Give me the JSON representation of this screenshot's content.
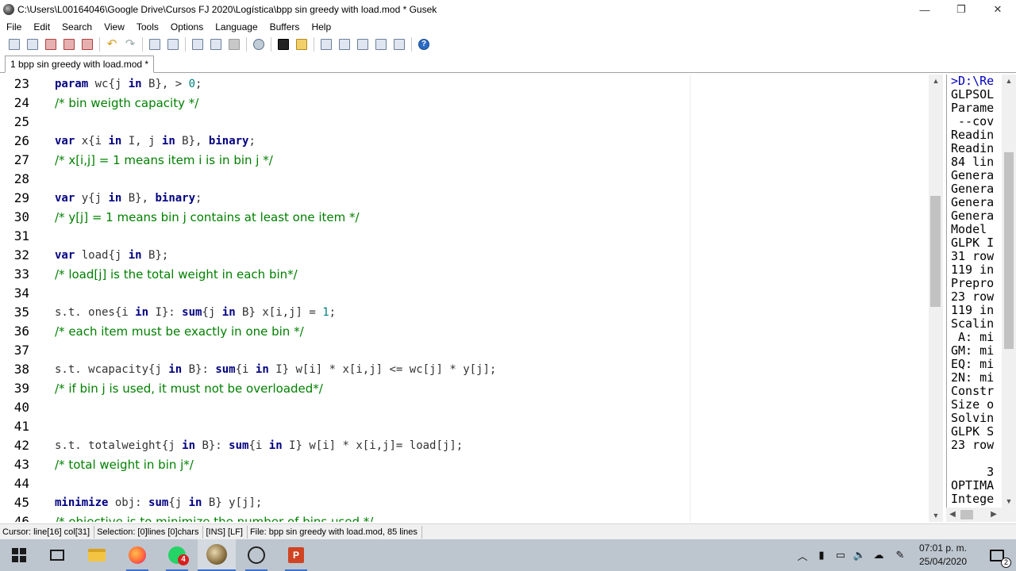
{
  "window": {
    "title": "C:\\Users\\L00164046\\Google Drive\\Cursos FJ 2020\\Logística\\bpp sin greedy with load.mod * Gusek",
    "minimize": "—",
    "restore": "❐",
    "close": "✕"
  },
  "menu": [
    "File",
    "Edit",
    "Search",
    "View",
    "Tools",
    "Options",
    "Language",
    "Buffers",
    "Help"
  ],
  "toolbar": {
    "icons": [
      "new-file-icon",
      "open-file-icon",
      "save-icon",
      "save-all-icon",
      "close-file-icon",
      "undo-icon",
      "redo-icon",
      "find-icon",
      "replace-icon",
      "export-icon",
      "run-icon",
      "stop-icon",
      "settings-icon",
      "console-icon",
      "open-folder-icon",
      "bold-icon",
      "format-icon",
      "indent-icon",
      "fullscreen-icon",
      "image-icon",
      "help-icon"
    ],
    "help_label": "?"
  },
  "tab": {
    "label": "1 bpp sin greedy with load.mod *"
  },
  "editor": {
    "lines": [
      {
        "n": "23",
        "type": "code"
      },
      {
        "n": "24",
        "type": "comment",
        "text": "/* bin weigth capacity */"
      },
      {
        "n": "25",
        "type": "blank"
      },
      {
        "n": "26",
        "type": "code"
      },
      {
        "n": "27",
        "type": "comment",
        "text": "/* x[i,j] = 1 means item i is in bin j */"
      },
      {
        "n": "28",
        "type": "blank"
      },
      {
        "n": "29",
        "type": "code"
      },
      {
        "n": "30",
        "type": "comment",
        "text": "/* y[j] = 1 means bin j contains at least one item */"
      },
      {
        "n": "31",
        "type": "blank"
      },
      {
        "n": "32",
        "type": "code"
      },
      {
        "n": "33",
        "type": "comment",
        "text": "/* load[j] is the total weight in each bin*/"
      },
      {
        "n": "34",
        "type": "blank"
      },
      {
        "n": "35",
        "type": "code"
      },
      {
        "n": "36",
        "type": "comment",
        "text": "/* each item must be exactly in one bin */"
      },
      {
        "n": "37",
        "type": "blank"
      },
      {
        "n": "38",
        "type": "code"
      },
      {
        "n": "39",
        "type": "comment",
        "text": "/* if bin j is used, it must not be overloaded*/"
      },
      {
        "n": "40",
        "type": "blank"
      },
      {
        "n": "41",
        "type": "blank"
      },
      {
        "n": "42",
        "type": "code"
      },
      {
        "n": "43",
        "type": "comment",
        "text": "/* total weight in bin j*/"
      },
      {
        "n": "44",
        "type": "blank"
      },
      {
        "n": "45",
        "type": "code"
      },
      {
        "n": "46",
        "type": "comment",
        "text": "/* objective is to minimize the number of bins used */"
      }
    ],
    "code": {
      "l23": [
        "param",
        " wc{j ",
        "in",
        " B}, > ",
        "0",
        ";"
      ],
      "l26": [
        "var",
        " x{i ",
        "in",
        " I, j ",
        "in",
        " B}, ",
        "binary",
        ";"
      ],
      "l29": [
        "var",
        " y{j ",
        "in",
        " B}, ",
        "binary",
        ";"
      ],
      "l32": [
        "var",
        " load{j ",
        "in",
        " B};"
      ],
      "l35": [
        "s.t. ones{i ",
        "in",
        " I}: ",
        "sum",
        "{j ",
        "in",
        " B} x[i,j] = ",
        "1",
        ";"
      ],
      "l38": [
        "s.t. wcapacity{j ",
        "in",
        " B}: ",
        "sum",
        "{i ",
        "in",
        " I} w[i] * x[i,j] <= wc[j] * y[j];"
      ],
      "l42": [
        "s.t. totalweight{j ",
        "in",
        " B}: ",
        "sum",
        "{i ",
        "in",
        " I} w[i] * x[i,j]= load[j];"
      ],
      "l45": [
        "minimize",
        " obj: ",
        "sum",
        "{j ",
        "in",
        " B} y[j];"
      ]
    }
  },
  "output": {
    "lines": [
      ">D:\\Re",
      "GLPSOL",
      "Parame",
      " --cov",
      "Readin",
      "Readin",
      "84 lin",
      "Genera",
      "Genera",
      "Genera",
      "Genera",
      "Model",
      "GLPK I",
      "31 row",
      "119 in",
      "Prepro",
      "23 row",
      "119 in",
      "Scalin",
      " A: mi",
      "GM: mi",
      "EQ: mi",
      "2N: mi",
      "Constr",
      "Size o",
      "Solvin",
      "GLPK S",
      "23 row",
      "",
      "     3",
      "OPTIMA",
      "Intege"
    ]
  },
  "status": {
    "cursor": "Cursor: line[16] col[31]",
    "selection": "Selection: [0]lines [0]chars",
    "mode": "[INS] [LF]",
    "file": "File: bpp sin greedy with load.mod, 85 lines"
  },
  "taskbar": {
    "whatsapp_badge": "4",
    "ppt_letter": "P",
    "time": "07:01 p. m.",
    "date": "25/04/2020",
    "notifications": "2"
  }
}
